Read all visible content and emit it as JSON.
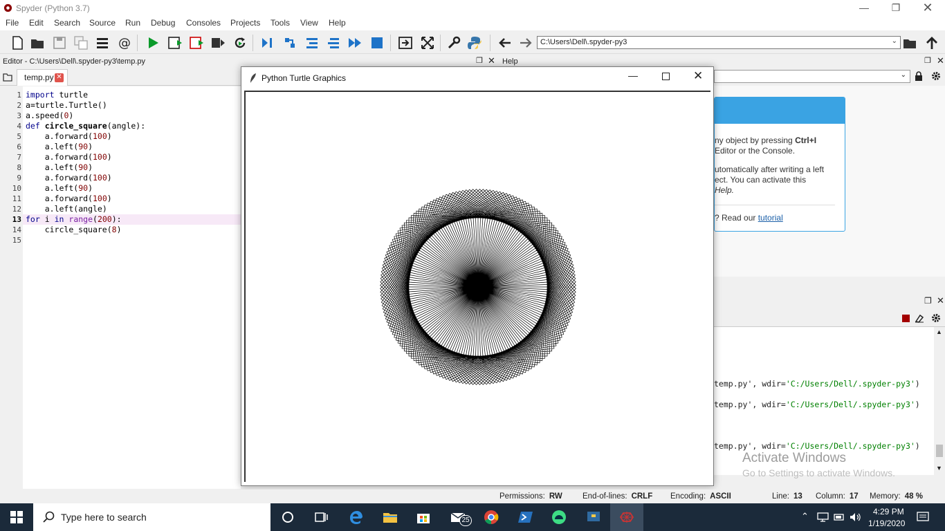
{
  "window": {
    "title": "Spyder (Python 3.7)"
  },
  "menu": [
    "File",
    "Edit",
    "Search",
    "Source",
    "Run",
    "Debug",
    "Consoles",
    "Projects",
    "Tools",
    "View",
    "Help"
  ],
  "toolbar": {
    "path": "C:\\Users\\Dell\\.spyder-py3"
  },
  "editor": {
    "header": "Editor - C:\\Users\\Dell\\.spyder-py3\\temp.py",
    "tab_label": "temp.py",
    "current_line": 13,
    "lines": [
      "import turtle",
      "a=turtle.Turtle()",
      "a.speed(0)",
      "def circle_square(angle):",
      "    a.forward(100)",
      "    a.left(90)",
      "    a.forward(100)",
      "    a.left(90)",
      "    a.forward(100)",
      "    a.left(90)",
      "    a.forward(100)",
      "    a.left(angle)",
      "for i in range(200):",
      "    circle_square(8)",
      ""
    ]
  },
  "help": {
    "header": "Help",
    "text1_pre": "ny object by pressing ",
    "text1_bold": "Ctrl+I",
    "text1_line2": "Editor or the Console.",
    "text2_line1": "utomatically after writing a left",
    "text2_line2": "ect. You can activate this",
    "text2_line3": "Help.",
    "text3": "? Read our ",
    "tutorial_link": "tutorial"
  },
  "console": {
    "lines": [
      {
        "pre": "temp.py', wdir=",
        "path": "'C:/Users/Dell/.spyder-py3'",
        "post": ")"
      },
      {
        "pre": "temp.py', wdir=",
        "path": "'C:/Users/Dell/.spyder-py3'",
        "post": ")"
      },
      {
        "pre": "temp.py', wdir=",
        "path": "'C:/Users/Dell/.spyder-py3'",
        "post": ")"
      }
    ]
  },
  "watermark": {
    "line1": "Activate Windows",
    "line2": "Go to Settings to activate Windows."
  },
  "turtle_window": {
    "title": "Python Turtle Graphics",
    "squares": 200,
    "side": 100,
    "turn_angle": 8
  },
  "statusbar": {
    "permissions_label": "Permissions:",
    "permissions_value": "RW",
    "eol_label": "End-of-lines:",
    "eol_value": "CRLF",
    "encoding_label": "Encoding:",
    "encoding_value": "ASCII",
    "line_label": "Line:",
    "line_value": "13",
    "column_label": "Column:",
    "column_value": "17",
    "memory_label": "Memory:",
    "memory_value": "48 %"
  },
  "taskbar": {
    "search_placeholder": "Type here to search",
    "mail_badge": "25",
    "time": "4:29 PM",
    "date": "1/19/2020"
  }
}
